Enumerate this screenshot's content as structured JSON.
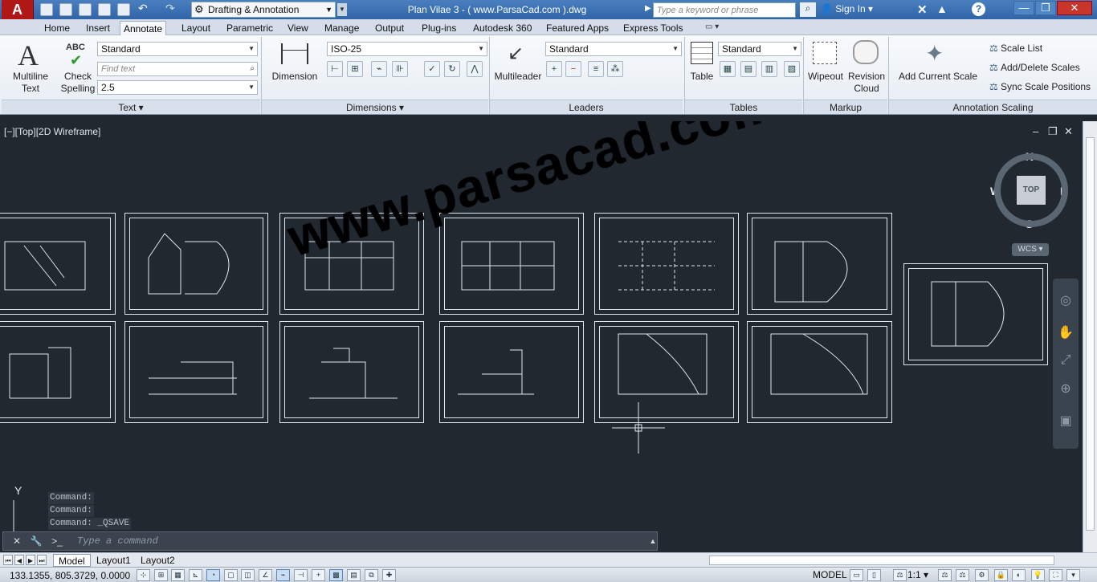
{
  "titlebar": {
    "app_logo": "A",
    "workspace": "Drafting & Annotation",
    "document_title": "Plan Vilae 3 - ( www.ParsaCad.com ).dwg",
    "search_placeholder": "Type a keyword or phrase",
    "sign_in": "Sign In",
    "help": "?",
    "minimize": "—",
    "restore": "❐",
    "close": "✕"
  },
  "tabs": [
    "Home",
    "Insert",
    "Annotate",
    "Layout",
    "Parametric",
    "View",
    "Manage",
    "Output",
    "Plug-ins",
    "Autodesk 360",
    "Featured Apps",
    "Express Tools"
  ],
  "active_tab": "Annotate",
  "ribbon": {
    "text_panel": {
      "title": "Text",
      "multiline_text": "Multiline Text",
      "check_spelling": "Check Spelling",
      "abc": "ABC",
      "text_style": "Standard",
      "find_placeholder": "Find text",
      "text_height": "2.5"
    },
    "dimensions_panel": {
      "title": "Dimensions",
      "dimension": "Dimension",
      "dim_style": "ISO-25"
    },
    "leaders_panel": {
      "title": "Leaders",
      "multileader": "Multileader",
      "leader_style": "Standard"
    },
    "tables_panel": {
      "title": "Tables",
      "table": "Table",
      "table_style": "Standard"
    },
    "markup_panel": {
      "title": "Markup",
      "wipeout": "Wipeout",
      "revision_cloud": "Revision Cloud"
    },
    "scaling_panel": {
      "title": "Annotation Scaling",
      "add_current_scale": "Add Current Scale",
      "scale_list": "Scale List",
      "add_delete_scales": "Add/Delete Scales",
      "sync_scale_positions": "Sync Scale Positions"
    }
  },
  "viewport": {
    "label": "[−][Top][2D Wireframe]",
    "watermark": "www.parsacad.com",
    "compass": {
      "n": "N",
      "s": "S",
      "e": "E",
      "w": "W"
    },
    "viewcube_top": "TOP",
    "wcs": "WCS ▾"
  },
  "command_history": [
    "Command:",
    "Command:",
    "Command: _QSAVE"
  ],
  "command_placeholder": "Type a command",
  "layout_tabs": [
    "Model",
    "Layout1",
    "Layout2"
  ],
  "active_layout": "Model",
  "status": {
    "coordinates": "133.1355, 805.3729, 0.0000",
    "model": "MODEL",
    "annotation_scale": "1:1 ▾"
  },
  "colors": {
    "canvas": "#212830",
    "title_blue": "#2f65a8",
    "logo_red": "#b01818",
    "linework": "#dfe6ee"
  }
}
